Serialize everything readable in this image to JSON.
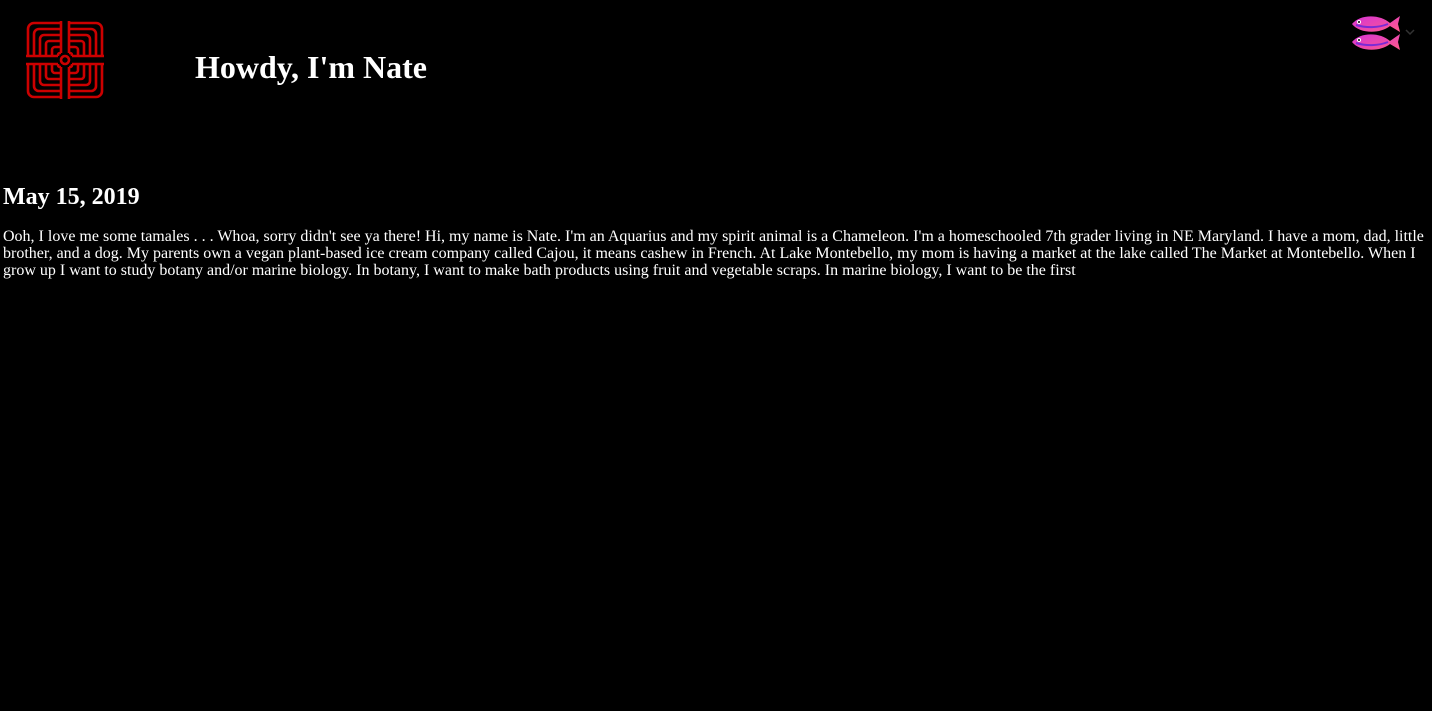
{
  "header": {
    "title": "Howdy, I'm Nate",
    "logo_icon": "red-square-maze-logo-icon",
    "menu_icon": "pink-fish-icon",
    "menu_chevron_icon": "chevron-down-icon"
  },
  "post": {
    "date": "May 15, 2019",
    "body": "Ooh, I love me some tamales . . . Whoa, sorry didn't see ya there! Hi, my name is Nate. I'm an Aquarius and my spirit animal is a Chameleon. I'm a homeschooled 7th grader living in NE Maryland. I have a mom, dad, little brother, and a dog. My parents own a vegan plant-based ice cream company called Cajou, it means cashew in French. At Lake Montebello, my mom is having a market at the lake called The Market at Montebello. When I grow up I want to study botany and/or marine biology. In botany, I want to make bath products using fruit and vegetable scraps. In marine biology, I want to be the first"
  },
  "colors": {
    "background": "#000000",
    "text": "#ffffff",
    "logo": "#cc0000",
    "fish_top": "#d633d6",
    "fish_bottom": "#ff5a8a",
    "fish_stripe": "#7a2bd6"
  }
}
